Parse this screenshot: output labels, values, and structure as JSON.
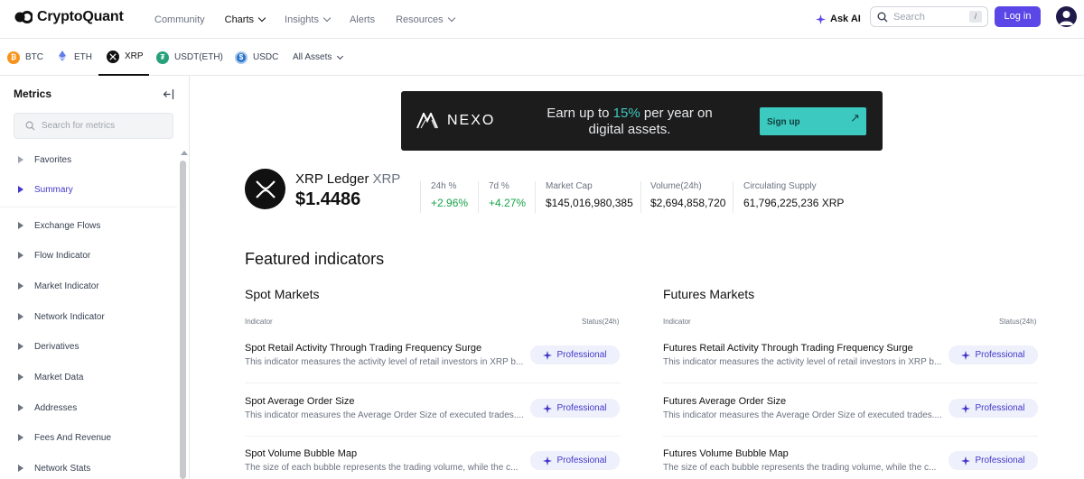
{
  "brand": {
    "name": "CryptoQuant"
  },
  "nav": {
    "community": "Community",
    "charts": "Charts",
    "insights": "Insights",
    "alerts": "Alerts",
    "resources": "Resources",
    "ask_ai": "Ask AI",
    "search_placeholder": "Search",
    "search_shortcut": "/",
    "login": "Log in"
  },
  "assets": [
    {
      "symbol": "BTC",
      "color": "#f7931a"
    },
    {
      "symbol": "ETH",
      "color": "#627eea"
    },
    {
      "symbol": "XRP",
      "color": "#111111"
    },
    {
      "symbol": "USDT(ETH)",
      "color": "#26a17b"
    },
    {
      "symbol": "USDC",
      "color": "#2775ca"
    },
    {
      "symbol": "All Assets"
    }
  ],
  "sidebar": {
    "title": "Metrics",
    "search_placeholder": "Search for metrics",
    "items": [
      "Favorites",
      "Summary",
      "Exchange Flows",
      "Flow Indicator",
      "Market Indicator",
      "Network Indicator",
      "Derivatives",
      "Market Data",
      "Addresses",
      "Fees And Revenue",
      "Network Stats"
    ]
  },
  "banner": {
    "brand": "NEXO",
    "text_before": "Earn up to ",
    "highlight": "15%",
    "text_after": " per year on digital assets.",
    "cta": "Sign up",
    "cta_arrow": "↗"
  },
  "coin": {
    "name": "XRP Ledger",
    "symbol": "XRP",
    "price": "$1.4486",
    "stats": [
      {
        "label": "24h %",
        "value": "+2.96%"
      },
      {
        "label": "7d %",
        "value": "+4.27%"
      },
      {
        "label": "Market Cap",
        "value": "$145,016,980,385"
      },
      {
        "label": "Volume(24h)",
        "value": "$2,694,858,720"
      },
      {
        "label": "Circulating Supply",
        "value": "61,796,225,236 XRP"
      }
    ]
  },
  "featured": {
    "title": "Featured indicators",
    "spot": {
      "title": "Spot Markets",
      "col_indicator": "Indicator",
      "col_status": "Status(24h)",
      "rows": [
        {
          "title": "Spot Retail Activity Through Trading Frequency Surge",
          "desc": "This indicator measures the activity level of retail investors in XRP b...",
          "badge": "Professional"
        },
        {
          "title": "Spot Average Order Size",
          "desc": "This indicator measures the Average Order Size of executed trades....",
          "badge": "Professional"
        },
        {
          "title": "Spot Volume Bubble Map",
          "desc": "The size of each bubble represents the trading volume, while the c...",
          "badge": "Professional"
        }
      ]
    },
    "futures": {
      "title": "Futures Markets",
      "col_indicator": "Indicator",
      "col_status": "Status(24h)",
      "rows": [
        {
          "title": "Futures Retail Activity Through Trading Frequency Surge",
          "desc": "This indicator measures the activity level of retail investors in XRP b...",
          "badge": "Professional"
        },
        {
          "title": "Futures Average Order Size",
          "desc": "This indicator measures the Average Order Size of executed trades....",
          "badge": "Professional"
        },
        {
          "title": "Futures Volume Bubble Map",
          "desc": "The size of each bubble represents the trading volume, while the c...",
          "badge": "Professional"
        }
      ]
    }
  }
}
